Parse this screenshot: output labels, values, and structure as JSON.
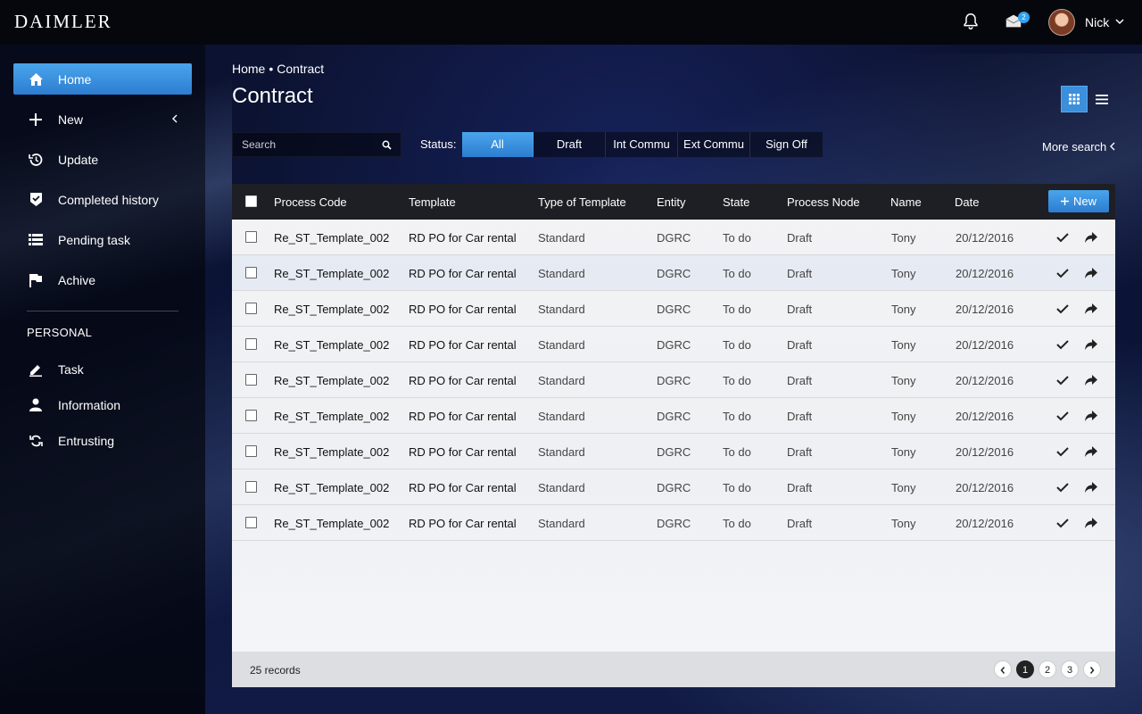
{
  "app": {
    "logo": "DAIMLER",
    "user_name": "Nick",
    "mail_count": "2"
  },
  "sidebar": {
    "items": [
      {
        "label": "Home",
        "icon": "home-icon",
        "active": true
      },
      {
        "label": "New",
        "icon": "plus-icon"
      },
      {
        "label": "Update",
        "icon": "history-icon"
      },
      {
        "label": "Completed history",
        "icon": "check-badge-icon"
      },
      {
        "label": "Pending task",
        "icon": "list-icon"
      },
      {
        "label": "Achive",
        "icon": "flag-icon"
      }
    ],
    "section_label": "PERSONAL",
    "personal": [
      {
        "label": "Task",
        "icon": "pencil-icon"
      },
      {
        "label": "Information",
        "icon": "person-icon"
      },
      {
        "label": "Entrusting",
        "icon": "refresh-icon"
      }
    ]
  },
  "breadcrumb": {
    "home": "Home",
    "separator": "•",
    "current": "Contract"
  },
  "page_title": "Contract",
  "search": {
    "placeholder": "Search",
    "value": ""
  },
  "status": {
    "label": "Status:",
    "tabs": [
      "All",
      "Draft",
      "Int Commu",
      "Ext Commu",
      "Sign Off"
    ],
    "active": "All"
  },
  "more_search": "More search",
  "table": {
    "columns": [
      "Process Code",
      "Template",
      "Type of Template",
      "Entity",
      "State",
      "Process Node",
      "Name",
      "Date"
    ],
    "new_button": "New",
    "rows": [
      [
        "Re_ST_Template_002",
        "RD PO for Car rental",
        "Standard",
        "DGRC",
        "To do",
        "Draft",
        "Tony",
        "20/12/2016"
      ],
      [
        "Re_ST_Template_002",
        "RD PO for Car rental",
        "Standard",
        "DGRC",
        "To do",
        "Draft",
        "Tony",
        "20/12/2016"
      ],
      [
        "Re_ST_Template_002",
        "RD PO for Car rental",
        "Standard",
        "DGRC",
        "To do",
        "Draft",
        "Tony",
        "20/12/2016"
      ],
      [
        "Re_ST_Template_002",
        "RD PO for Car rental",
        "Standard",
        "DGRC",
        "To do",
        "Draft",
        "Tony",
        "20/12/2016"
      ],
      [
        "Re_ST_Template_002",
        "RD PO for Car rental",
        "Standard",
        "DGRC",
        "To do",
        "Draft",
        "Tony",
        "20/12/2016"
      ],
      [
        "Re_ST_Template_002",
        "RD PO for Car rental",
        "Standard",
        "DGRC",
        "To do",
        "Draft",
        "Tony",
        "20/12/2016"
      ],
      [
        "Re_ST_Template_002",
        "RD PO for Car rental",
        "Standard",
        "DGRC",
        "To do",
        "Draft",
        "Tony",
        "20/12/2016"
      ],
      [
        "Re_ST_Template_002",
        "RD PO for Car rental",
        "Standard",
        "DGRC",
        "To do",
        "Draft",
        "Tony",
        "20/12/2016"
      ],
      [
        "Re_ST_Template_002",
        "RD PO for Car rental",
        "Standard",
        "DGRC",
        "To do",
        "Draft",
        "Tony",
        "20/12/2016"
      ]
    ],
    "records": "25 records",
    "pages": [
      "1",
      "2",
      "3"
    ],
    "current_page": "1"
  },
  "colors": {
    "accent": "#3b8fdb",
    "topbar": "#05070d",
    "table_header": "#1d1f24"
  }
}
